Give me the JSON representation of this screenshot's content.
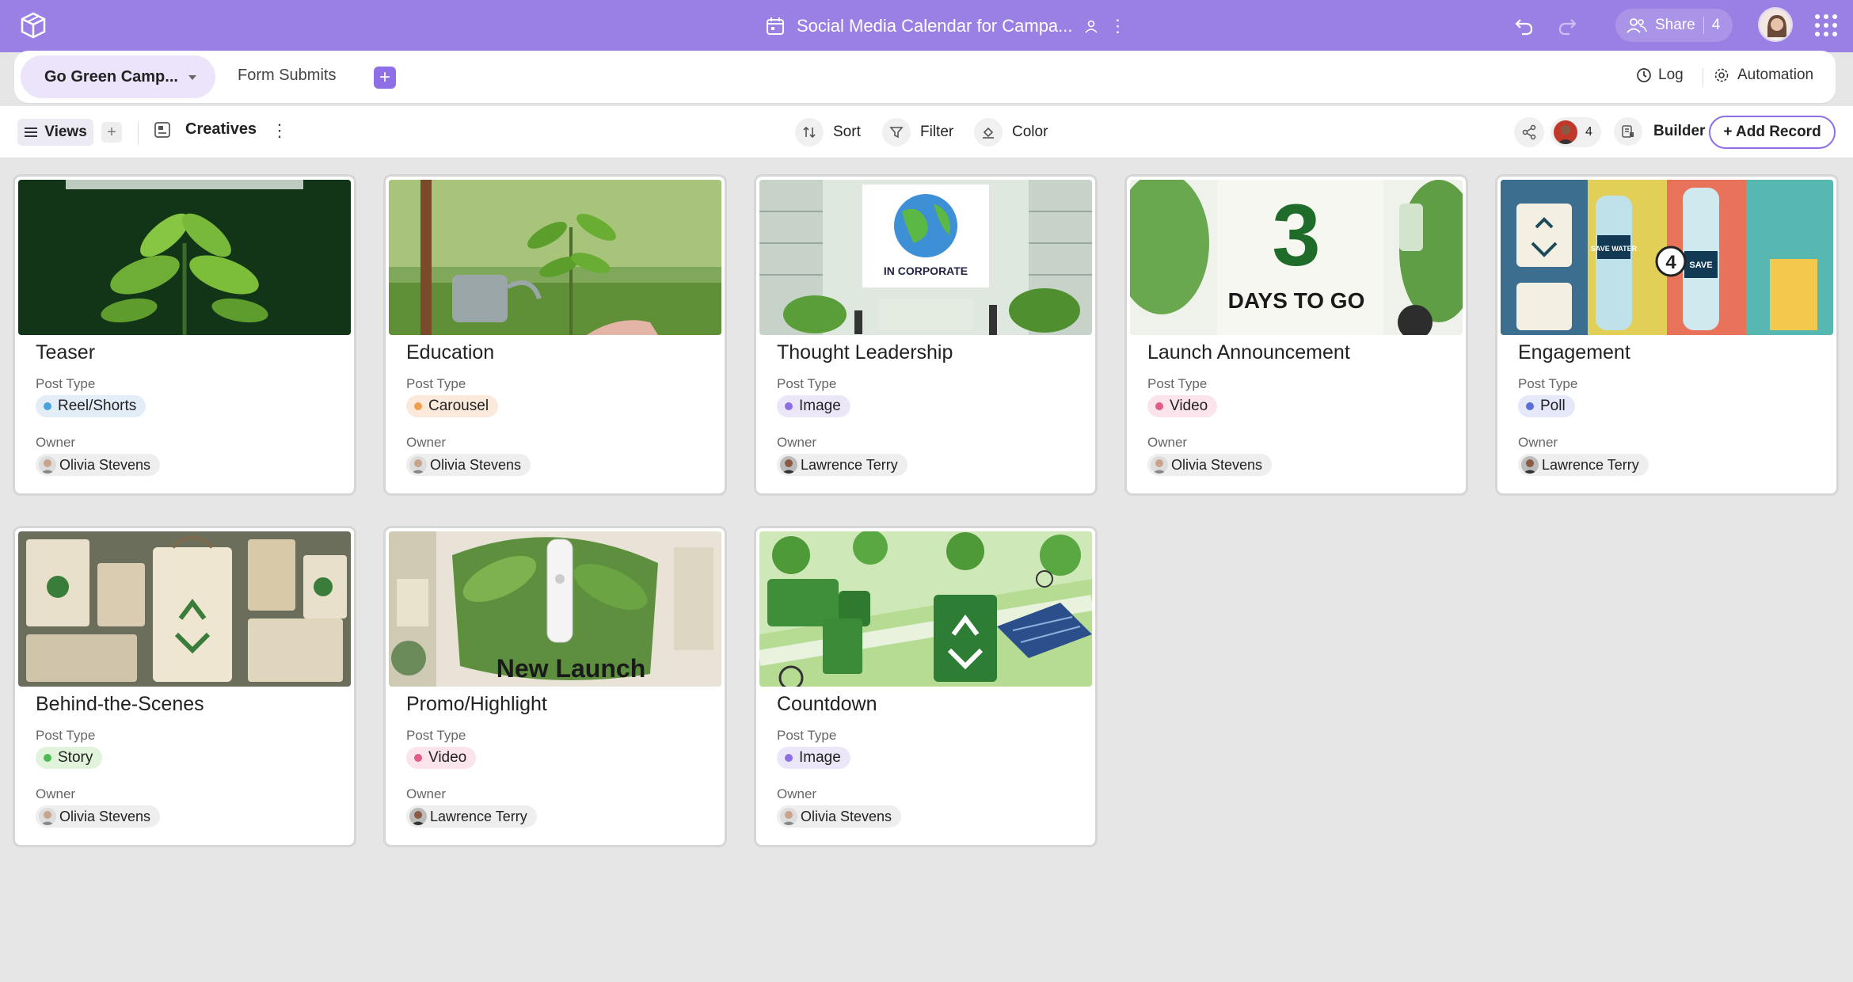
{
  "header": {
    "title": "Social Media Calendar for Campa...",
    "share_label": "Share",
    "share_count": "4"
  },
  "tabs": {
    "active": "Go Green Camp...",
    "second": "Form Submits",
    "add": "+",
    "log": "Log",
    "automation": "Automation"
  },
  "toolbar": {
    "views": "Views",
    "add": "+",
    "view_name": "Creatives",
    "sort": "Sort",
    "filter": "Filter",
    "color": "Color",
    "collaborators": "4",
    "builder": "Builder",
    "add_record": "+ Add Record"
  },
  "labels": {
    "post_type": "Post Type",
    "owner": "Owner"
  },
  "colors": {
    "accent": "#9a80e4",
    "button_purple": "#8e6fe5"
  },
  "cards": [
    {
      "title": "Teaser",
      "post_type": "Reel/Shorts",
      "owner": "Olivia Stevens",
      "image_text": ""
    },
    {
      "title": "Education",
      "post_type": "Carousel",
      "owner": "Olivia Stevens",
      "image_text": ""
    },
    {
      "title": "Thought Leadership",
      "post_type": "Image",
      "owner": "Lawrence Terry",
      "image_text": "IN CORPORATE"
    },
    {
      "title": "Launch Announcement",
      "post_type": "Video",
      "owner": "Olivia Stevens",
      "image_text": "DAYS TO GO"
    },
    {
      "title": "Engagement",
      "post_type": "Poll",
      "owner": "Lawrence Terry",
      "image_text": "SAVE WATER"
    },
    {
      "title": "Behind-the-Scenes",
      "post_type": "Story",
      "owner": "Olivia Stevens",
      "image_text": ""
    },
    {
      "title": "Promo/Highlight",
      "post_type": "Video",
      "owner": "Lawrence Terry",
      "image_text": "New Launch"
    },
    {
      "title": "Countdown",
      "post_type": "Image",
      "owner": "Olivia Stevens",
      "image_text": ""
    }
  ]
}
